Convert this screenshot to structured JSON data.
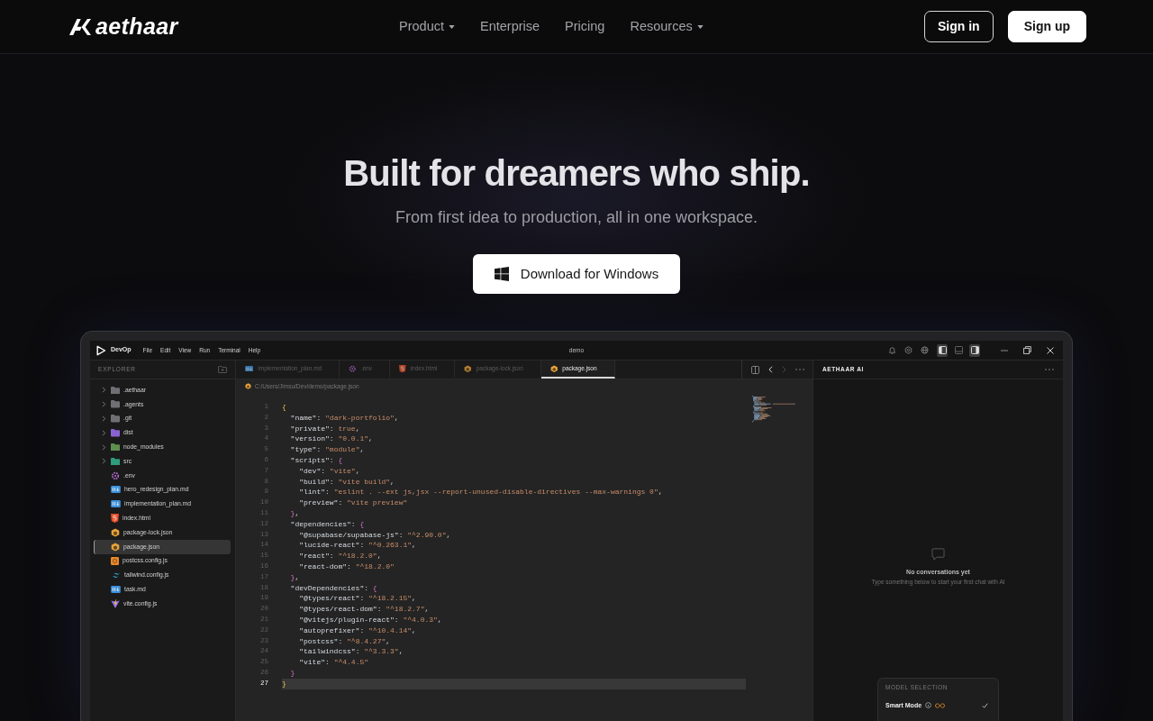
{
  "nav": {
    "logo": "aethaar",
    "links": [
      {
        "label": "Product",
        "kind": "dropdown"
      },
      {
        "label": "Enterprise",
        "kind": "link"
      },
      {
        "label": "Pricing",
        "kind": "link"
      },
      {
        "label": "Resources",
        "kind": "dropdown"
      }
    ],
    "buttons": [
      {
        "label": "Sign in",
        "kind": "outline"
      },
      {
        "label": "Sign up",
        "kind": "solid"
      }
    ]
  },
  "hero": {
    "title": "Built for dreamers who ship.",
    "subtitle": "From first idea to production, all in one workspace.",
    "download_button": "Download for Windows"
  },
  "ide": {
    "app_name": "DevOp",
    "menu": [
      "File",
      "Edit",
      "View",
      "Run",
      "Terminal",
      "Help"
    ],
    "window_title": "demo",
    "panel_toggles": [
      {
        "on": true
      },
      {
        "on": false
      },
      {
        "on": true
      }
    ],
    "explorer": {
      "title": "EXPLORER",
      "items": [
        {
          "name": ".aethaar",
          "kind": "folder",
          "color": "#6f6f74",
          "expanded": false,
          "selected": false
        },
        {
          "name": ".agents",
          "kind": "folder",
          "color": "#6f6f74",
          "expanded": false,
          "selected": false
        },
        {
          "name": ".git",
          "kind": "folder",
          "color": "#6f6f74",
          "expanded": false,
          "selected": false
        },
        {
          "name": "dist",
          "kind": "folder",
          "color": "#8a63d2",
          "expanded": false,
          "selected": false
        },
        {
          "name": "node_modules",
          "kind": "folder",
          "color": "#5f8f4e",
          "expanded": false,
          "selected": false
        },
        {
          "name": "src",
          "kind": "folder",
          "color": "#2f9c7e",
          "expanded": false,
          "selected": false
        },
        {
          "name": ".env",
          "kind": "env",
          "selected": false
        },
        {
          "name": "hero_redesign_plan.md",
          "kind": "markdown",
          "selected": false
        },
        {
          "name": "implementation_plan.md",
          "kind": "markdown",
          "selected": false
        },
        {
          "name": "index.html",
          "kind": "html",
          "selected": false
        },
        {
          "name": "package-lock.json",
          "kind": "json",
          "selected": false
        },
        {
          "name": "package.json",
          "kind": "json",
          "selected": true
        },
        {
          "name": "postcss.config.js",
          "kind": "postcss",
          "selected": false
        },
        {
          "name": "tailwind.config.js",
          "kind": "tailwind",
          "selected": false
        },
        {
          "name": "task.md",
          "kind": "markdown",
          "selected": false
        },
        {
          "name": "vite.config.js",
          "kind": "vite",
          "selected": false
        }
      ]
    },
    "tabs": [
      {
        "label": "implementation_plan.md",
        "kind": "markdown",
        "selected": false
      },
      {
        "label": ".env",
        "kind": "env",
        "selected": false
      },
      {
        "label": "index.html",
        "kind": "html",
        "selected": false
      },
      {
        "label": "package-lock.json",
        "kind": "json",
        "selected": false
      },
      {
        "label": "package.json",
        "kind": "json",
        "selected": true
      }
    ],
    "breadcrumb": "C:/Users/Jimsu/Dev/demo/package.json",
    "lines": [
      {
        "number": "1",
        "text": "{",
        "current": false
      },
      {
        "number": "2",
        "text": "  \"name\": \"dark-portfolio\",",
        "current": false
      },
      {
        "number": "3",
        "text": "  \"private\": true,",
        "current": false
      },
      {
        "number": "4",
        "text": "  \"version\": \"0.0.1\",",
        "current": false
      },
      {
        "number": "5",
        "text": "  \"type\": \"module\",",
        "current": false
      },
      {
        "number": "6",
        "text": "  \"scripts\": {",
        "current": false
      },
      {
        "number": "7",
        "text": "    \"dev\": \"vite\",",
        "current": false
      },
      {
        "number": "8",
        "text": "    \"build\": \"vite build\",",
        "current": false
      },
      {
        "number": "9",
        "text": "    \"lint\": \"eslint . --ext js,jsx --report-unused-disable-directives --max-warnings 0\",",
        "current": false
      },
      {
        "number": "10",
        "text": "    \"preview\": \"vite preview\"",
        "current": false
      },
      {
        "number": "11",
        "text": "  },",
        "current": false
      },
      {
        "number": "12",
        "text": "  \"dependencies\": {",
        "current": false
      },
      {
        "number": "13",
        "text": "    \"@supabase/supabase-js\": \"^2.90.0\",",
        "current": false
      },
      {
        "number": "14",
        "text": "    \"lucide-react\": \"^0.263.1\",",
        "current": false
      },
      {
        "number": "15",
        "text": "    \"react\": \"^18.2.0\",",
        "current": false
      },
      {
        "number": "16",
        "text": "    \"react-dom\": \"^18.2.0\"",
        "current": false
      },
      {
        "number": "17",
        "text": "  },",
        "current": false
      },
      {
        "number": "18",
        "text": "  \"devDependencies\": {",
        "current": false
      },
      {
        "number": "19",
        "text": "    \"@types/react\": \"^18.2.15\",",
        "current": false
      },
      {
        "number": "20",
        "text": "    \"@types/react-dom\": \"^18.2.7\",",
        "current": false
      },
      {
        "number": "21",
        "text": "    \"@vitejs/plugin-react\": \"^4.0.3\",",
        "current": false
      },
      {
        "number": "22",
        "text": "    \"autoprefixer\": \"^10.4.14\",",
        "current": false
      },
      {
        "number": "23",
        "text": "    \"postcss\": \"^8.4.27\",",
        "current": false
      },
      {
        "number": "24",
        "text": "    \"tailwindcss\": \"^3.3.3\",",
        "current": false
      },
      {
        "number": "25",
        "text": "    \"vite\": \"^4.4.5\"",
        "current": false
      },
      {
        "number": "26",
        "text": "  }",
        "current": false
      },
      {
        "number": "27",
        "text": "}",
        "current": true
      }
    ],
    "ai_panel": {
      "title": "AETHAAR AI",
      "empty_title": "No conversations yet",
      "empty_hint": "Type something below to start your first chat with AI",
      "model_card": {
        "heading": "MODEL SELECTION",
        "option": "Smart Mode",
        "selected": true
      }
    }
  }
}
